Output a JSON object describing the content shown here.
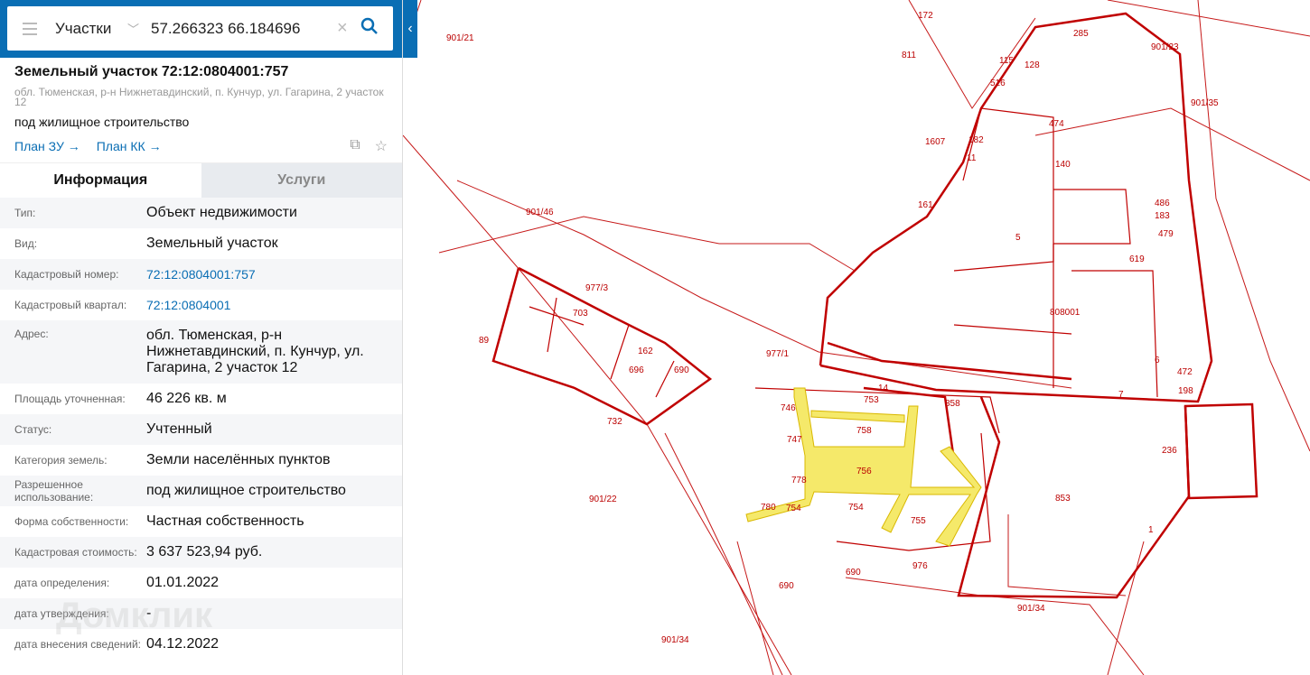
{
  "search": {
    "layer": "Участки",
    "query": "57.266323 66.184696"
  },
  "parcel": {
    "title": "Земельный участок 72:12:0804001:757",
    "address": "обл. Тюменская, р-н Нижнетавдинский, п. Кунчур, ул. Гагарина, 2 участок 12",
    "purpose": "под жилищное строительство",
    "links": [
      "План ЗУ →",
      "План КК →"
    ]
  },
  "tabs": [
    "Информация",
    "Услуги"
  ],
  "rows": [
    {
      "label": "Тип:",
      "value": "Объект недвижимости"
    },
    {
      "label": "Вид:",
      "value": "Земельный участок"
    },
    {
      "label": "Кадастровый номер:",
      "value": "72:12:0804001:757"
    },
    {
      "label": "Кадастровый квартал:",
      "value": "72:12:0804001"
    },
    {
      "label": "Адрес:",
      "value": "обл. Тюменская, р-н Нижнетавдинский, п. Кунчур, ул. Гагарина, 2 участок 12"
    },
    {
      "label": "Площадь уточненная:",
      "value": "46 226 кв. м"
    },
    {
      "label": "Статус:",
      "value": "Учтенный"
    },
    {
      "label": "Категория земель:",
      "value": "Земли населённых пунктов"
    },
    {
      "label": "Разрешенное использование:",
      "value": "под жилищное строительство"
    },
    {
      "label": "Форма собственности:",
      "value": "Частная собственность"
    },
    {
      "label": "Кадастровая стоимость:",
      "value": "3 637 523,94 руб."
    },
    {
      "label": "дата определения:",
      "value": "01.01.2022"
    },
    {
      "label": "дата утверждения:",
      "value": "-"
    },
    {
      "label": "дата внесения сведений:",
      "value": "04.12.2022"
    }
  ],
  "watermark": "Домклик",
  "map": {
    "labels": [
      "901/21",
      "901/23",
      "901/35",
      "901/46",
      "977/3",
      "89",
      "977/1",
      "808001",
      "5",
      "1607",
      "6",
      "198",
      "236",
      "853",
      "1",
      "901/22",
      "690",
      "690",
      "901/34",
      "901/34",
      "758",
      "756",
      "754",
      "754",
      "753",
      "14",
      "732",
      "703",
      "696",
      "690",
      "162",
      "811",
      "474",
      "486",
      "183",
      "472",
      "115",
      "128",
      "516",
      "172",
      "285",
      "182",
      "140",
      "11",
      "161",
      "479",
      "619",
      "7",
      "746",
      "747",
      "778",
      "780",
      "755",
      "976",
      "858"
    ]
  },
  "colors": {
    "brand": "#0a6eb4",
    "parcel": "#c00000",
    "road": "#f5e96a"
  }
}
